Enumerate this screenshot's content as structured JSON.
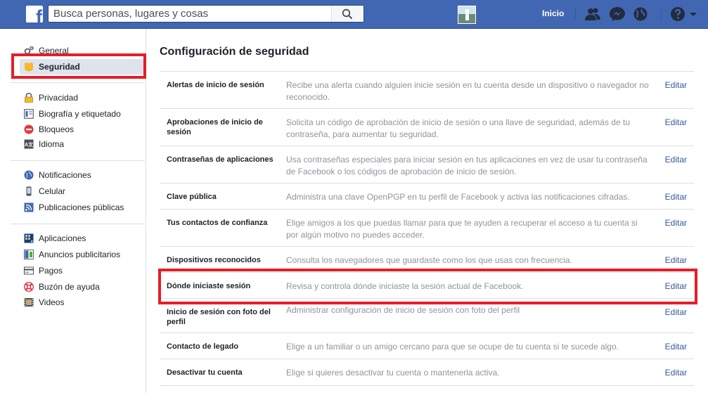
{
  "topbar": {
    "search_placeholder": "Busca personas, lugares y cosas",
    "home_label": "Inicio",
    "brand_color": "#4267b2"
  },
  "sidebar": {
    "items": [
      {
        "label": "General",
        "icon": "gear-icon"
      },
      {
        "label": "Seguridad",
        "icon": "security-badge-icon",
        "active": true
      },
      {
        "label": "Privacidad",
        "icon": "lock-icon"
      },
      {
        "label": "Biografía y etiquetado",
        "icon": "timeline-icon"
      },
      {
        "label": "Bloqueos",
        "icon": "block-icon"
      },
      {
        "label": "Idioma",
        "icon": "language-icon"
      },
      {
        "label": "Notificaciones",
        "icon": "globe-icon"
      },
      {
        "label": "Celular",
        "icon": "mobile-icon"
      },
      {
        "label": "Publicaciones públicas",
        "icon": "rss-icon"
      },
      {
        "label": "Aplicaciones",
        "icon": "apps-icon"
      },
      {
        "label": "Anuncios publicitarios",
        "icon": "ads-icon"
      },
      {
        "label": "Pagos",
        "icon": "credit-card-icon"
      },
      {
        "label": "Buzón de ayuda",
        "icon": "lifebuoy-icon"
      },
      {
        "label": "Videos",
        "icon": "film-icon"
      }
    ]
  },
  "main": {
    "title": "Configuración de seguridad",
    "edit_label": "Editar",
    "rows": [
      {
        "label": "Alertas de inicio de sesión",
        "desc": "Recibe una alerta cuando alguien inicie sesión en tu cuenta desde un dispositivo o navegador no reconocido."
      },
      {
        "label": "Aprobaciones de inicio de sesión",
        "desc": "Solicita un código de aprobación de inicio de sesión o una llave de seguridad, además de tu contraseña, para aumentar tu seguridad."
      },
      {
        "label": "Contraseñas de aplicaciones",
        "desc": "Usa contraseñas especiales para iniciar sesión en tus aplicaciones en vez de usar tu contraseña de Facebook o los códigos de aprobación de inicio de sesión."
      },
      {
        "label": "Clave pública",
        "desc": "Administra una clave OpenPGP en tu perfil de Facebook y activa las notificaciones cifradas."
      },
      {
        "label": "Tus contactos de confianza",
        "desc": "Elige amigos a los que puedas llamar para que te ayuden a recuperar el acceso a tu cuenta si por algún motivo no puedes acceder."
      },
      {
        "label": "Dispositivos reconocidos",
        "desc": "Consulta los navegadores que guardaste como los que usas con frecuencia."
      },
      {
        "label": "Dónde iniciaste sesión",
        "desc": "Revisa y controla dónde iniciaste la sesión actual de Facebook."
      },
      {
        "label": "Inicio de sesión con foto del perfil",
        "desc": "Administrar configuración de inicio de sesión con foto del perfil"
      },
      {
        "label": "Contacto de legado",
        "desc": "Elige a un familiar o un amigo cercano para que se ocupe de tu cuenta si te sucede algo."
      },
      {
        "label": "Desactivar tu cuenta",
        "desc": "Elige si quieres desactivar tu cuenta o mantenerla activa."
      }
    ]
  },
  "highlight_color": "#e41e2a"
}
